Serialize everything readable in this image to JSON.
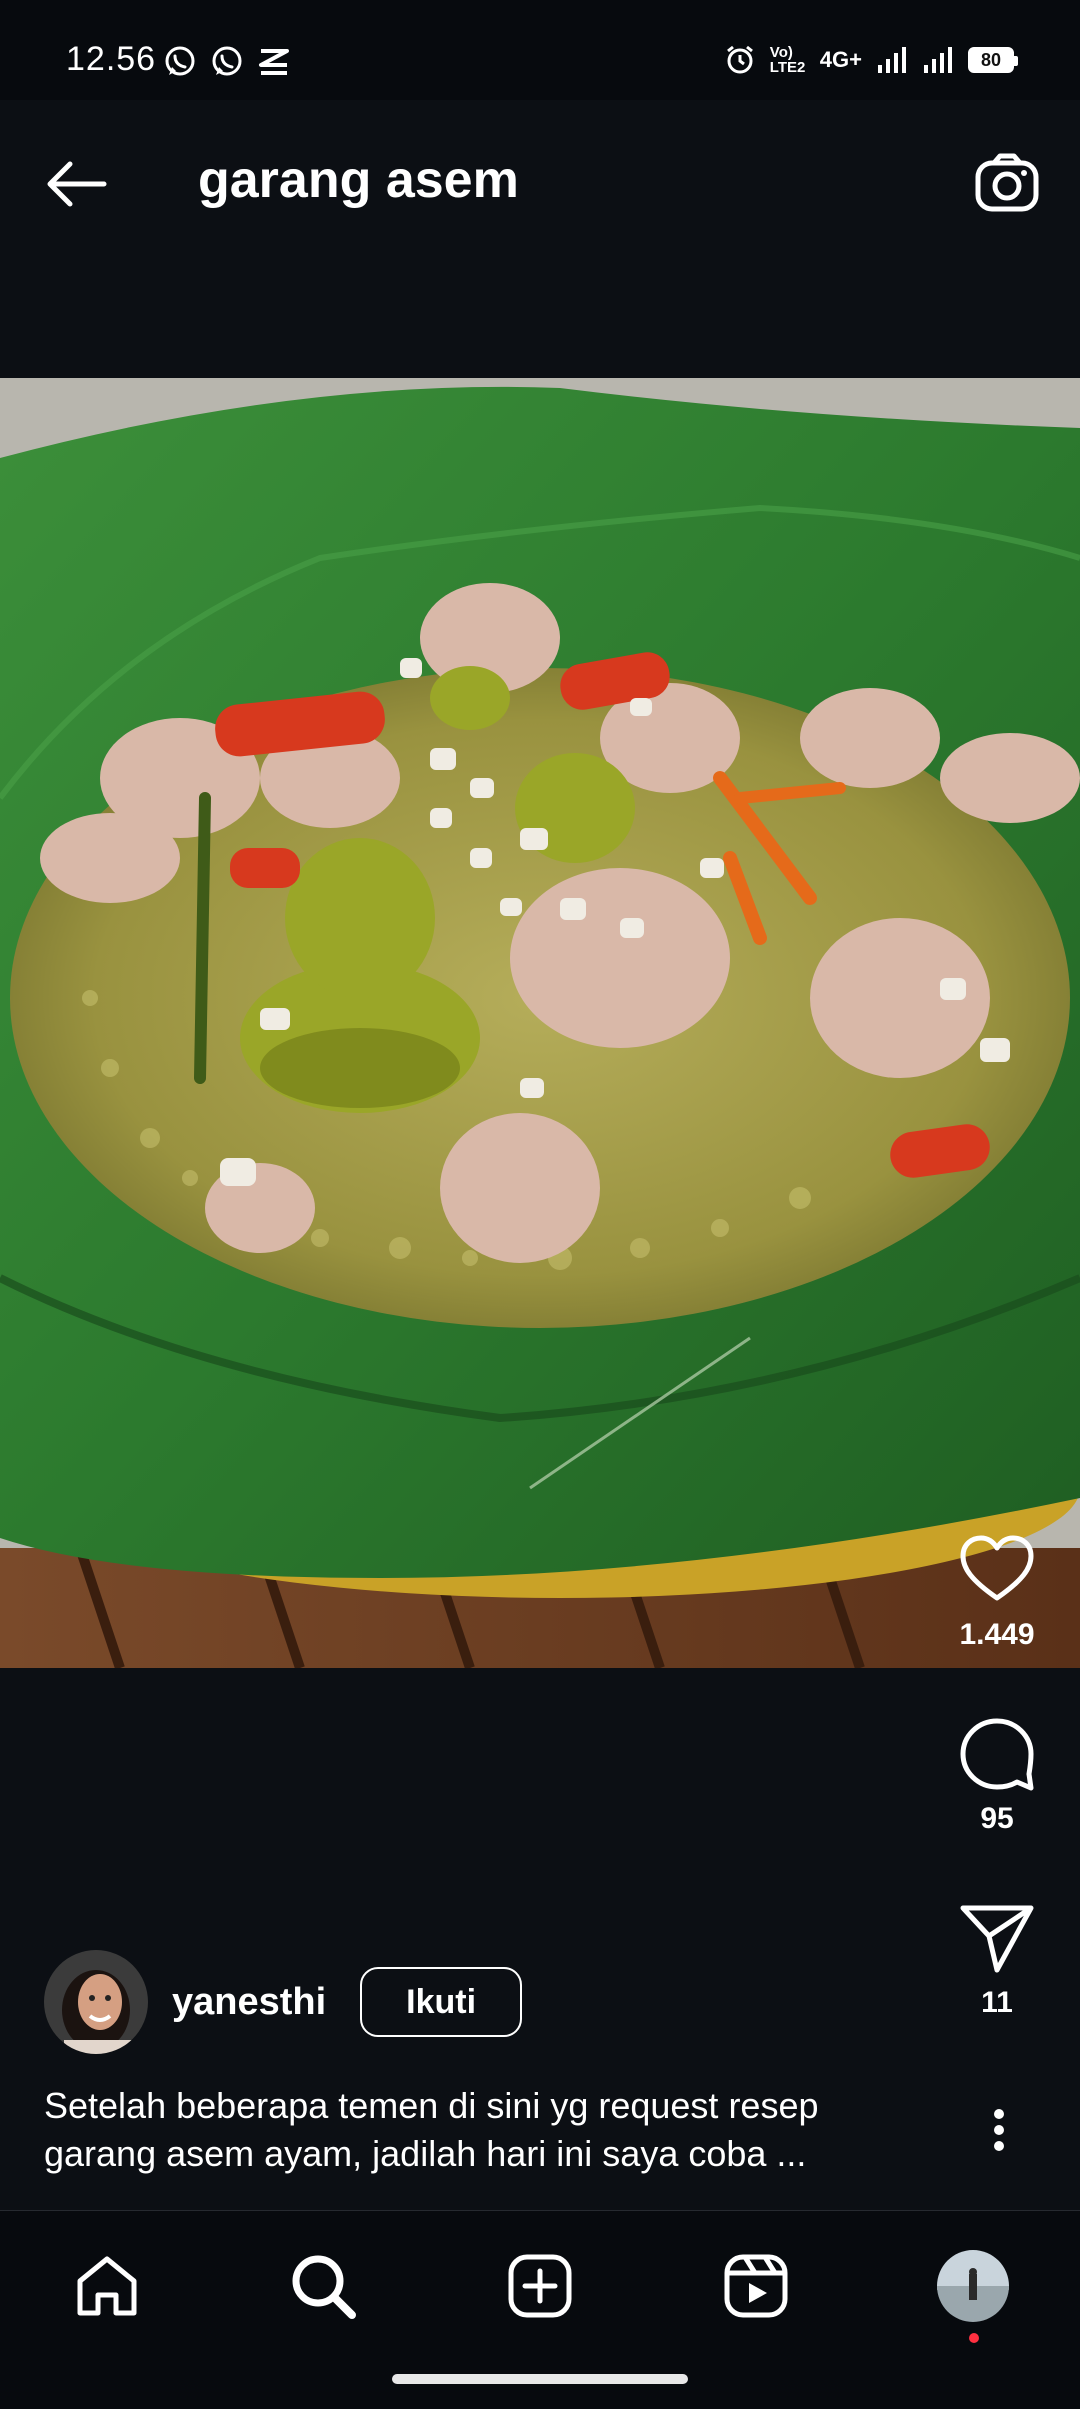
{
  "status_bar": {
    "time": "12.56",
    "left_icons": [
      "whatsapp-icon",
      "whatsapp-icon",
      "capcut-icon"
    ],
    "right_icons": [
      "alarm-icon",
      "volte-icon",
      "4g-plus-icon",
      "signal-icon",
      "signal-icon",
      "battery-icon"
    ],
    "volte_label": "Vo) LTE2",
    "network_label": "4G+",
    "battery": "80"
  },
  "header": {
    "title": "garang asem",
    "back_icon": "arrow-left-icon",
    "camera_icon": "camera-icon"
  },
  "post": {
    "image_description_icon": "food-photo",
    "likes": "1.449",
    "comments": "95",
    "shares": "11",
    "author": {
      "username": "yanesthi",
      "follow_label": "Ikuti"
    },
    "caption_line1": "Setelah beberapa temen di sini yg request resep",
    "caption_line2": "garang asem ayam, jadilah hari ini saya coba ..."
  },
  "bottom_nav": {
    "items": [
      "home-icon",
      "search-icon",
      "create-icon",
      "reels-icon",
      "profile-avatar"
    ]
  },
  "colors": {
    "background": "#0c0f14",
    "nav_background": "#070a0e",
    "notification_dot": "#ff3040",
    "leaf_green": "#2f7d32",
    "broth": "#a8a24a"
  }
}
